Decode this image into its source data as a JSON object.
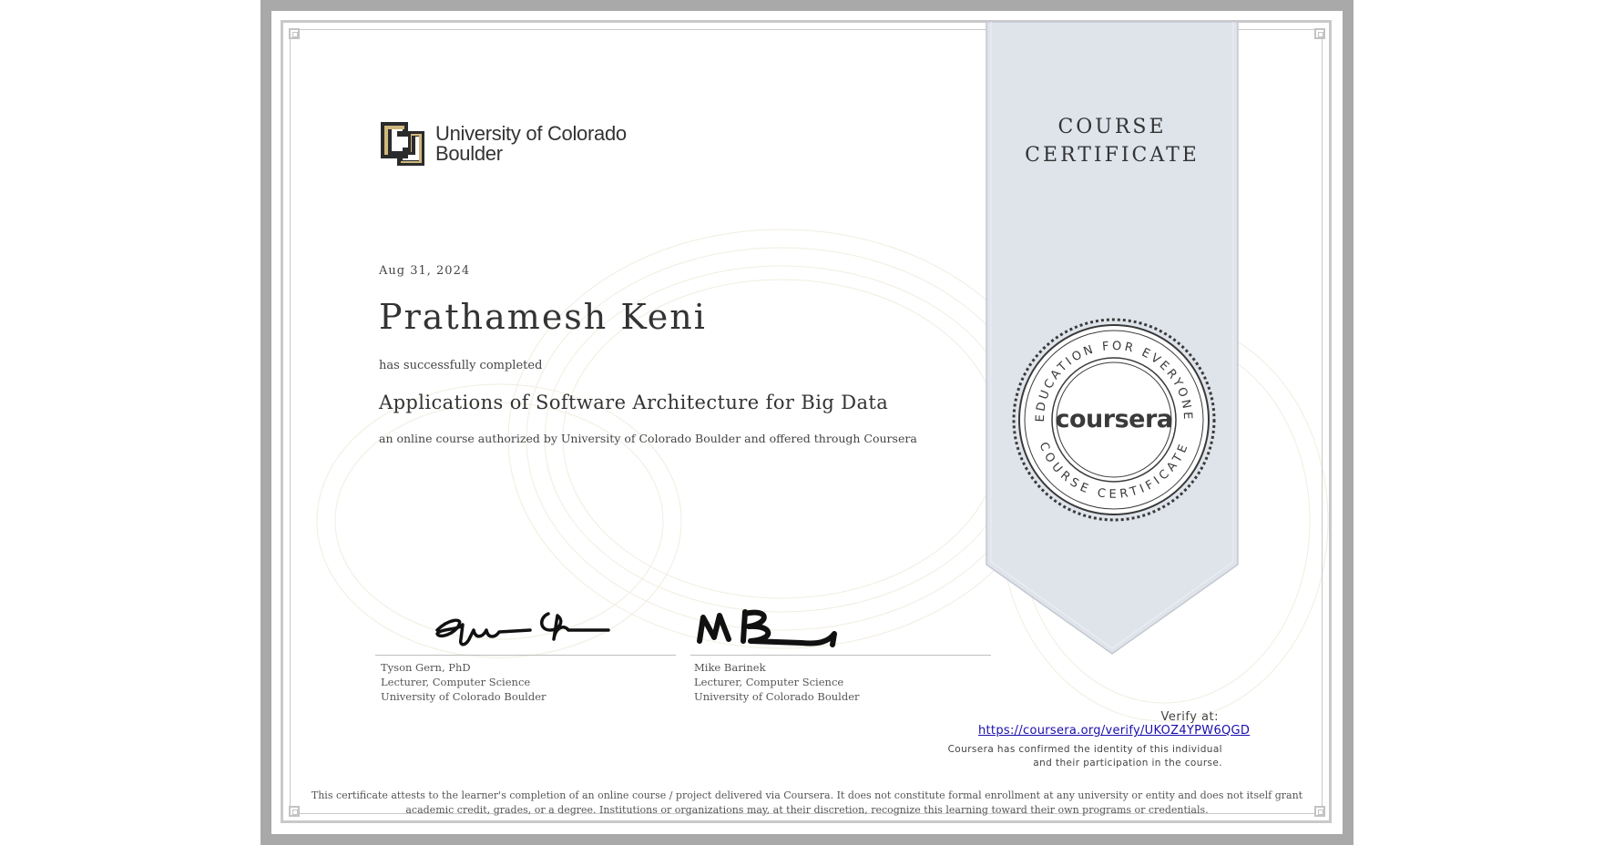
{
  "certificate": {
    "title_line1": "COURSE",
    "title_line2": "CERTIFICATE",
    "institution_line1": "University of Colorado",
    "institution_line2": "Boulder",
    "date": "Aug 31, 2024",
    "recipient": "Prathamesh Keni",
    "completed_text": "has successfully completed",
    "course_name": "Applications of Software Architecture for Big Data",
    "authorized_text": "an online course authorized by University of Colorado Boulder and offered through Coursera"
  },
  "signatories": [
    {
      "name": "Tyson Gern, PhD",
      "title": "Lecturer, Computer Science",
      "org": "University of Colorado Boulder"
    },
    {
      "name": "Mike Barinek",
      "title": "Lecturer, Computer Science",
      "org": "University of Colorado Boulder"
    }
  ],
  "seal": {
    "brand": "coursera",
    "top_text": "EDUCATION FOR EVERYONE",
    "bottom_text": "COURSE CERTIFICATE"
  },
  "verify": {
    "label": "Verify at:",
    "url": "https://coursera.org/verify/UKOZ4YPW6QGD",
    "confirm_text": "Coursera has confirmed the identity of this individual and their participation in the course."
  },
  "disclaimer": "This certificate attests to the learner's completion of an online course / project delivered via Coursera. It does not constitute formal enrollment at any university or entity and does not itself grant academic credit, grades, or a degree. Institutions or organizations may, at their discretion, recognize this learning toward their own programs or credentials.",
  "colors": {
    "ribbon": "#dfe3ea",
    "seal_dark": "#3a3a3a",
    "link": "#1a0dab",
    "frame": "#a9a9a9",
    "logo_gold": "#cfb87c"
  }
}
